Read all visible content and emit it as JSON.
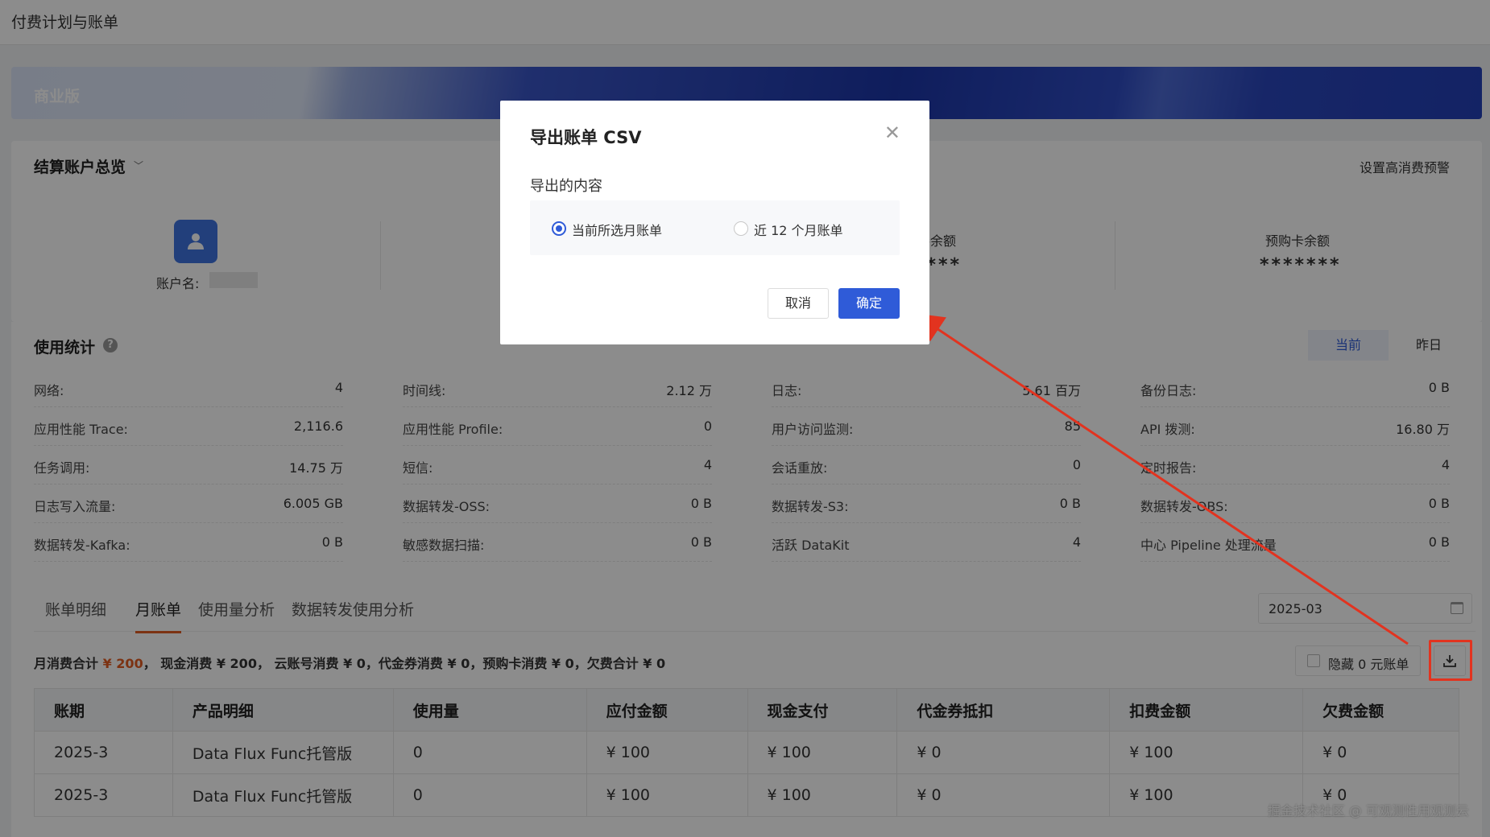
{
  "page": {
    "title": "付费计划与账单"
  },
  "plan": {
    "name": "商业版"
  },
  "overview": {
    "title": "结算账户总览",
    "alert_link": "设置高消费预警",
    "account_label": "账户名:",
    "cards": [
      {
        "label": "券余额",
        "value": "****"
      },
      {
        "label": "预购卡余额",
        "value": "*******"
      }
    ]
  },
  "usage": {
    "title": "使用统计",
    "help": "?",
    "toggle": {
      "current": "当前",
      "yesterday": "昨日"
    },
    "columns": [
      [
        {
          "label": "网络:",
          "value": "4"
        },
        {
          "label": "应用性能 Trace:",
          "value": "2,116.6"
        },
        {
          "label": "任务调用:",
          "value": "14.75 万"
        },
        {
          "label": "日志写入流量:",
          "value": "6.005 GB"
        },
        {
          "label": "数据转发-Kafka:",
          "value": "0 B"
        }
      ],
      [
        {
          "label": "时间线:",
          "value": "2.12 万"
        },
        {
          "label": "应用性能 Profile:",
          "value": "0"
        },
        {
          "label": "短信:",
          "value": "4"
        },
        {
          "label": "数据转发-OSS:",
          "value": "0 B"
        },
        {
          "label": "敏感数据扫描:",
          "value": "0 B"
        }
      ],
      [
        {
          "label": "日志:",
          "value": "5.61 百万"
        },
        {
          "label": "用户访问监测:",
          "value": "85"
        },
        {
          "label": "会话重放:",
          "value": "0"
        },
        {
          "label": "数据转发-S3:",
          "value": "0 B"
        },
        {
          "label": "活跃 DataKit",
          "value": "4"
        }
      ],
      [
        {
          "label": "备份日志:",
          "value": "0 B"
        },
        {
          "label": "API 拨测:",
          "value": "16.80 万"
        },
        {
          "label": "定时报告:",
          "value": "4"
        },
        {
          "label": "数据转发-OBS:",
          "value": "0 B"
        },
        {
          "label": "中心 Pipeline 处理流量",
          "value": "0 B"
        }
      ]
    ]
  },
  "bill": {
    "tabs": [
      "账单明细",
      "月账单",
      "使用量分析",
      "数据转发使用分析"
    ],
    "active_tab": 1,
    "date": "2025-03",
    "summary": {
      "total_label": "月消费合计",
      "total_value": "¥ 200",
      "rest": "，  现金消费 ¥ 200，  云账号消费 ¥ 0，代金券消费 ¥ 0，预购卡消费 ¥ 0，欠费合计 ¥ 0"
    },
    "hide_zero_label": "隐藏 0 元账单",
    "headers": [
      "账期",
      "产品明细",
      "使用量",
      "应付金额",
      "现金支付",
      "代金券抵扣",
      "扣费金额",
      "欠费金额"
    ],
    "rows": [
      [
        "2025-3",
        "Data Flux Func托管版",
        "0",
        "¥ 100",
        "¥ 100",
        "¥ 0",
        "¥ 100",
        "¥ 0"
      ],
      [
        "2025-3",
        "Data Flux Func托管版",
        "0",
        "¥ 100",
        "¥ 100",
        "¥ 0",
        "¥ 100",
        "¥ 0"
      ]
    ]
  },
  "dialog": {
    "title": "导出账单 CSV",
    "section": "导出的内容",
    "options": [
      "当前所选月账单",
      "近 12 个月账单"
    ],
    "selected": 0,
    "cancel": "取消",
    "confirm": "确定"
  },
  "watermark": "掘金技术社区 @ 可观测性用观测云",
  "colors": {
    "accent": "#2f5bd8",
    "highlight": "#e2331f",
    "orange": "#e25c22"
  },
  "icons": [
    "user-avatar-icon",
    "help-icon",
    "calendar-icon",
    "download-icon",
    "close-icon"
  ]
}
